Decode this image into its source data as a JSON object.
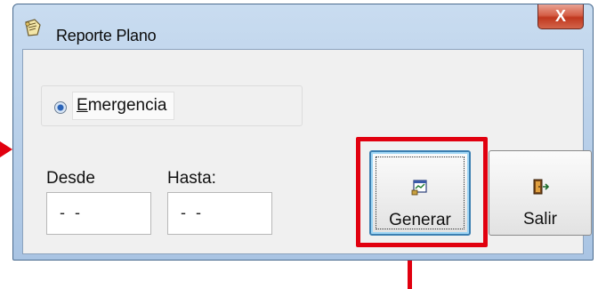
{
  "window": {
    "title": "Reporte Plano",
    "close_label": "X"
  },
  "option": {
    "label": "Emergencia",
    "mnemonic": "E",
    "rest": "mergencia",
    "selected": true
  },
  "range": {
    "from_label": "Desde",
    "to_label": "Hasta:",
    "from_value": "- -",
    "to_value": "- -"
  },
  "buttons": {
    "generate_label": "Generar",
    "exit_label": "Salir"
  },
  "colors": {
    "annotation": "#e1000f",
    "focus": "#3c7fb1"
  },
  "icons": {
    "app": "note-icon",
    "generate": "report-icon",
    "exit": "exit-door-icon"
  }
}
